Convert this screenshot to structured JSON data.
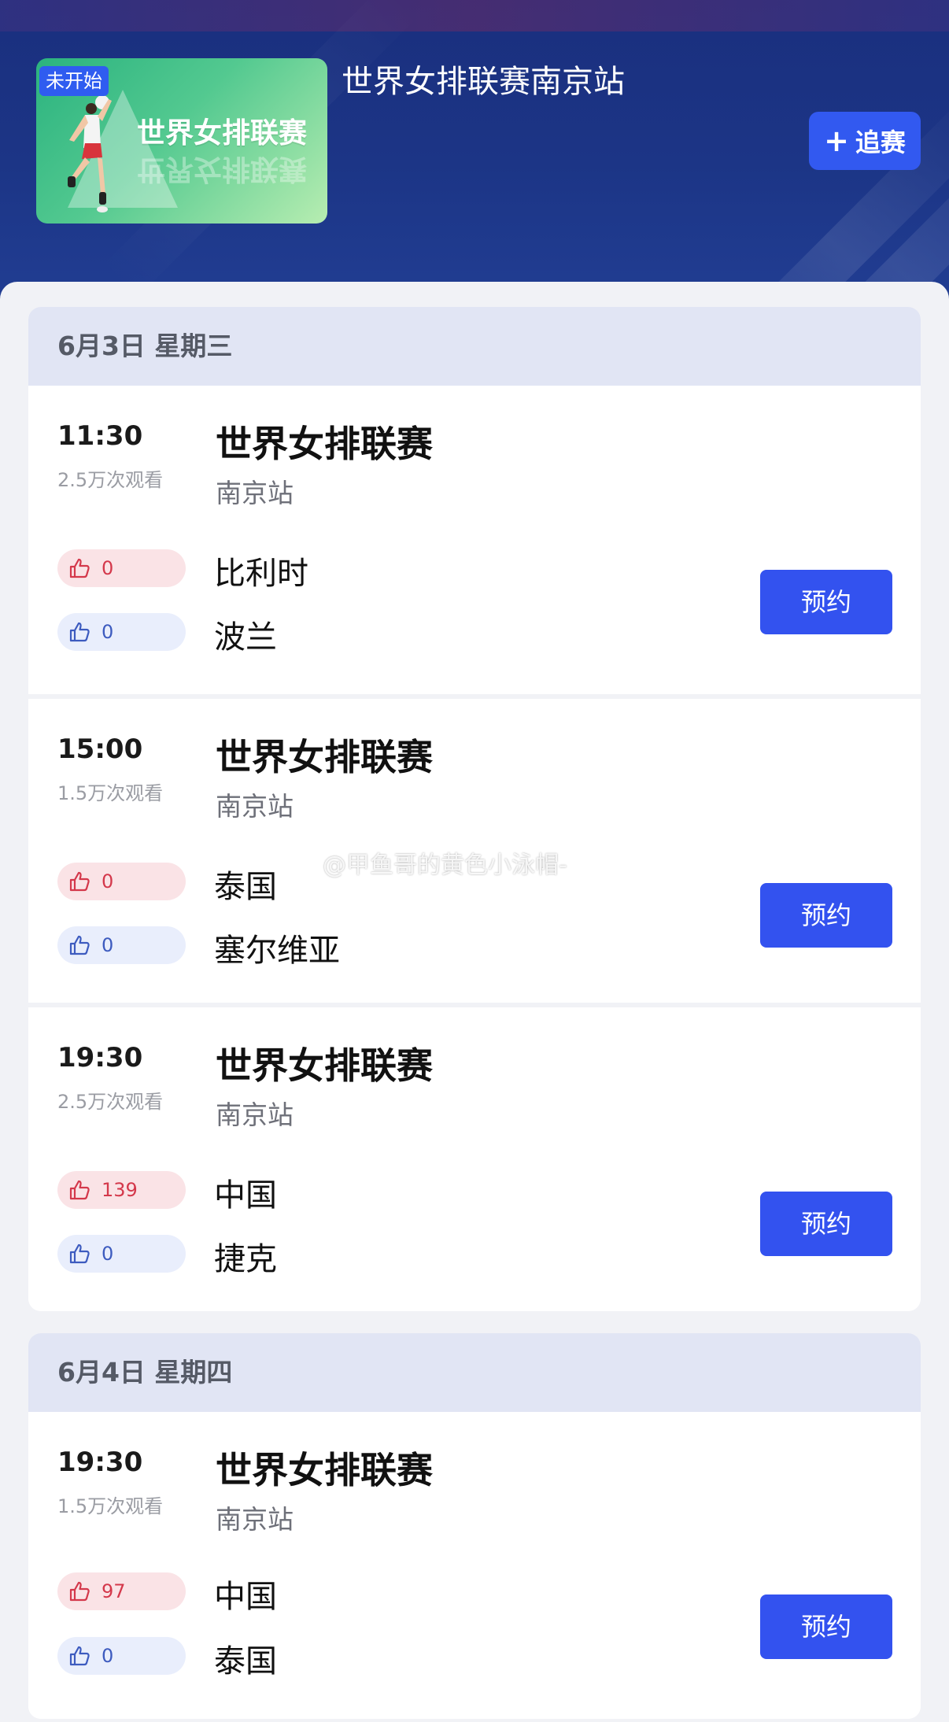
{
  "header": {
    "status_badge": "未开始",
    "cover_title": "世界女排联赛",
    "event_title": "世界女排联赛南京站",
    "follow_label": "追赛",
    "follow_icon": "plus-icon"
  },
  "days": [
    {
      "date_label": "6月3日 星期三",
      "matches": [
        {
          "time": "11:30",
          "views": "2.5万次观看",
          "title": "世界女排联赛",
          "subtitle": "南京站",
          "team1": "比利时",
          "team2": "波兰",
          "likes1": "0",
          "likes2": "0",
          "button": "预约"
        },
        {
          "time": "15:00",
          "views": "1.5万次观看",
          "title": "世界女排联赛",
          "subtitle": "南京站",
          "team1": "泰国",
          "team2": "塞尔维亚",
          "likes1": "0",
          "likes2": "0",
          "button": "预约"
        },
        {
          "time": "19:30",
          "views": "2.5万次观看",
          "title": "世界女排联赛",
          "subtitle": "南京站",
          "team1": "中国",
          "team2": "捷克",
          "likes1": "139",
          "likes2": "0",
          "button": "预约"
        }
      ]
    },
    {
      "date_label": "6月4日 星期四",
      "matches": [
        {
          "time": "19:30",
          "views": "1.5万次观看",
          "title": "世界女排联赛",
          "subtitle": "南京站",
          "team1": "中国",
          "team2": "泰国",
          "likes1": "97",
          "likes2": "0",
          "button": "预约"
        }
      ]
    }
  ],
  "watermark": "@甲鱼哥的黄色小泳帽-",
  "colors": {
    "header_bg": "#1c3586",
    "accent": "#3352ef",
    "like_red_bg": "#fae3e6",
    "like_blue_bg": "#e9eefc"
  }
}
